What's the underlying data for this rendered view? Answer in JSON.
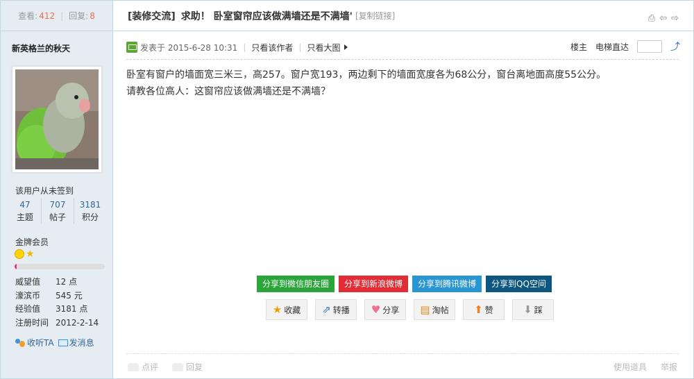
{
  "stats": {
    "views_label": "查看:",
    "views": "412",
    "replies_label": "回复:",
    "replies": "8"
  },
  "user": {
    "name": "新英格兰的秋天",
    "signin": "该用户从未签到",
    "counts": [
      {
        "value": "47",
        "label": "主题"
      },
      {
        "value": "707",
        "label": "帖子"
      },
      {
        "value": "3181",
        "label": "积分"
      }
    ],
    "group": "金牌会员",
    "progress": 0.02,
    "info": [
      {
        "k": "威望值",
        "v": "12 点"
      },
      {
        "k": "濠滨币",
        "v": "545 元"
      },
      {
        "k": "经验值",
        "v": "3181 点"
      },
      {
        "k": "注册时间",
        "v": "2012-2-14"
      }
    ],
    "actions": {
      "follow": "收听TA",
      "message": "发消息"
    }
  },
  "thread": {
    "category": "[装修交流]",
    "subject": "求助！ 卧室窗帘应该做满墙还是不满墙'",
    "copy_link": "[复制链接]"
  },
  "post": {
    "posted": "发表于 2015-6-28 10:31",
    "author_only": "只看该作者",
    "big_image": "只看大图",
    "floor": "楼主",
    "jump_label": "电梯直达",
    "content_line1": "卧室有窗户的墙面宽三米三，高257。窗户宽193，两边剩下的墙面宽度各为68公分，窗台离地面高度55公分。",
    "content_line2": "请教各位高人：这窗帘应该做满墙还是不满墙？"
  },
  "share": {
    "wechat": "分享到微信朋友圈",
    "weibo": "分享到新浪微博",
    "tencent": "分享到腾讯微博",
    "qzone": "分享到QQ空间"
  },
  "tools": {
    "favorite": "收藏",
    "forward": "转播",
    "share": "分享",
    "taotie": "淘帖",
    "like": "赞",
    "dislike": "踩"
  },
  "footer": {
    "comment": "点评",
    "reply": "回复",
    "use_tool": "使用道具",
    "report": "举报"
  },
  "colors": {
    "wechat": "#2aa53a",
    "weibo": "#e02d36",
    "tencent": "#2996d3",
    "qzone": "#0d567f"
  }
}
